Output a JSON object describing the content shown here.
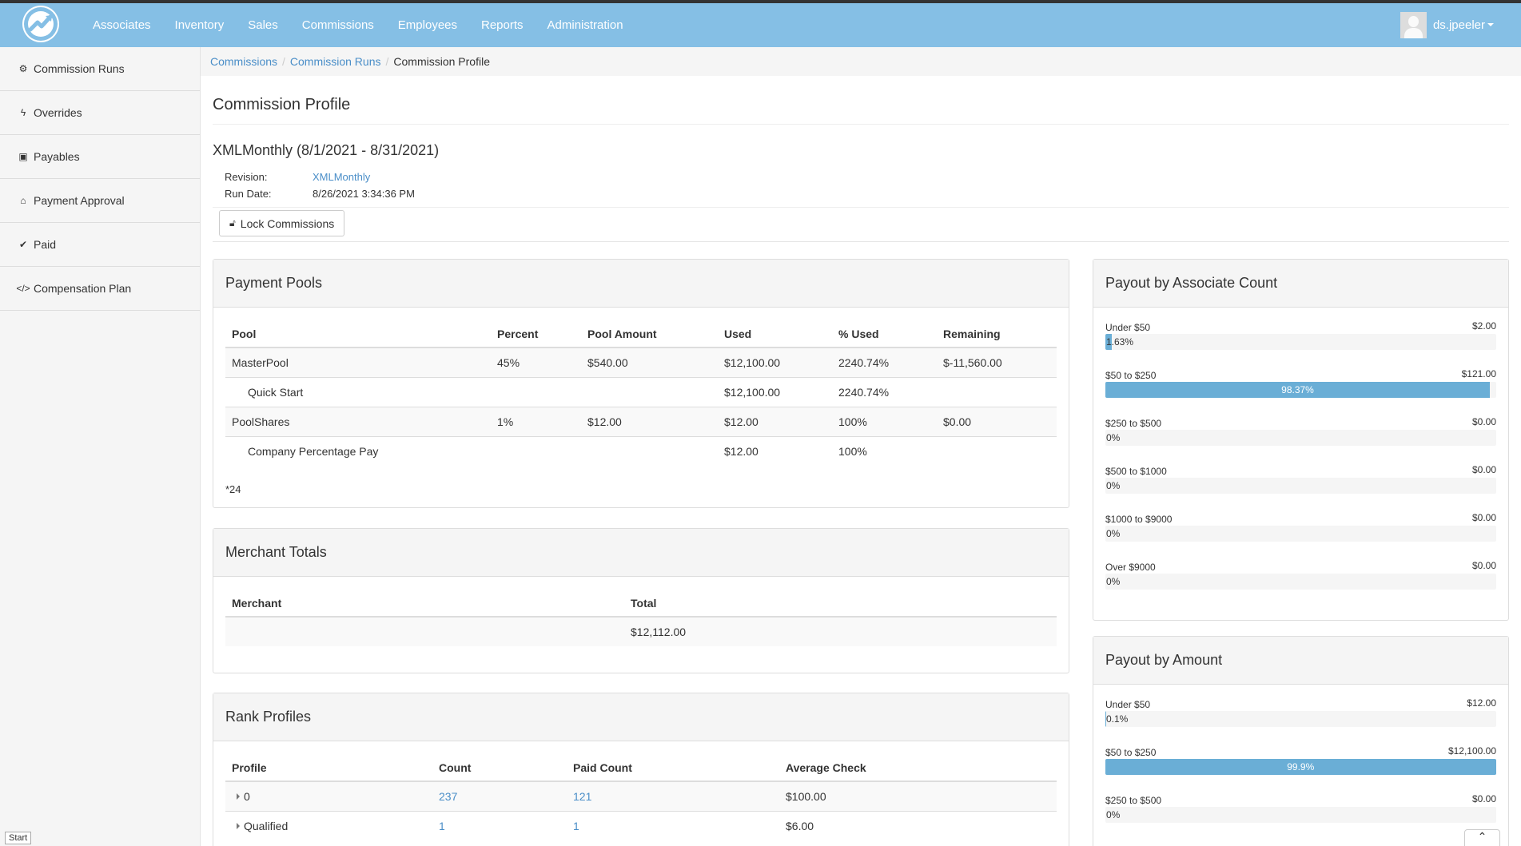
{
  "nav": {
    "items": [
      "Associates",
      "Inventory",
      "Sales",
      "Commissions",
      "Employees",
      "Reports",
      "Administration"
    ],
    "user": "ds.jpeeler"
  },
  "sidebar": {
    "items": [
      {
        "label": "Commission Runs",
        "icon": "gears-icon"
      },
      {
        "label": "Overrides",
        "icon": "bolt-icon"
      },
      {
        "label": "Payables",
        "icon": "money-icon"
      },
      {
        "label": "Payment Approval",
        "icon": "bank-icon"
      },
      {
        "label": "Paid",
        "icon": "check-icon"
      },
      {
        "label": "Compensation Plan",
        "icon": "code-icon"
      }
    ]
  },
  "breadcrumb": {
    "items": [
      "Commissions",
      "Commission Runs"
    ],
    "current": "Commission Profile"
  },
  "page": {
    "title": "Commission Profile",
    "run_title": "XMLMonthly (8/1/2021 - 8/31/2021)",
    "revision_label": "Revision:",
    "revision_value": "XMLMonthly",
    "run_date_label": "Run Date:",
    "run_date_value": "8/26/2021 3:34:36 PM",
    "lock_button": "Lock Commissions"
  },
  "payment_pools": {
    "title": "Payment Pools",
    "headers": [
      "Pool",
      "Percent",
      "Pool Amount",
      "Used",
      "% Used",
      "Remaining"
    ],
    "rows": [
      [
        "MasterPool",
        "45%",
        "$540.00",
        "$12,100.00",
        "2240.74%",
        "$-11,560.00"
      ],
      [
        "Quick Start",
        "",
        "",
        "$12,100.00",
        "2240.74%",
        ""
      ],
      [
        "PoolShares",
        "1%",
        "$12.00",
        "$12.00",
        "100%",
        "$0.00"
      ],
      [
        "Company Percentage Pay",
        "",
        "",
        "$12.00",
        "100%",
        ""
      ]
    ],
    "footnote": "*24"
  },
  "merchant_totals": {
    "title": "Merchant Totals",
    "headers": [
      "Merchant",
      "Total"
    ],
    "rows": [
      [
        "",
        "$12,112.00"
      ]
    ]
  },
  "rank_profiles": {
    "title": "Rank Profiles",
    "headers": [
      "Profile",
      "Count",
      "Paid Count",
      "Average Check"
    ],
    "rows": [
      [
        "0",
        "237",
        "121",
        "$100.00"
      ],
      [
        "Qualified",
        "1",
        "1",
        "$6.00"
      ]
    ]
  },
  "payout_by_count": {
    "title": "Payout by Associate Count",
    "bars": [
      {
        "label": "Under $50",
        "amount": "$2.00",
        "pct_text": "1.63%",
        "pct": 1.63
      },
      {
        "label": "$50 to $250",
        "amount": "$121.00",
        "pct_text": "98.37%",
        "pct": 98.37
      },
      {
        "label": "$250 to $500",
        "amount": "$0.00",
        "pct_text": "0%",
        "pct": 0
      },
      {
        "label": "$500 to $1000",
        "amount": "$0.00",
        "pct_text": "0%",
        "pct": 0
      },
      {
        "label": "$1000 to $9000",
        "amount": "$0.00",
        "pct_text": "0%",
        "pct": 0
      },
      {
        "label": "Over $9000",
        "amount": "$0.00",
        "pct_text": "0%",
        "pct": 0
      }
    ]
  },
  "payout_by_amount": {
    "title": "Payout by Amount",
    "bars": [
      {
        "label": "Under $50",
        "amount": "$12.00",
        "pct_text": "0.1%",
        "pct": 0.1
      },
      {
        "label": "$50 to $250",
        "amount": "$12,100.00",
        "pct_text": "99.9%",
        "pct": 99.9
      },
      {
        "label": "$250 to $500",
        "amount": "$0.00",
        "pct_text": "0%",
        "pct": 0
      }
    ]
  },
  "footer": {
    "start": "Start"
  },
  "colors": {
    "nav": "#85bfe5",
    "link": "#4a8ec8",
    "bar": "#6aaed6"
  }
}
